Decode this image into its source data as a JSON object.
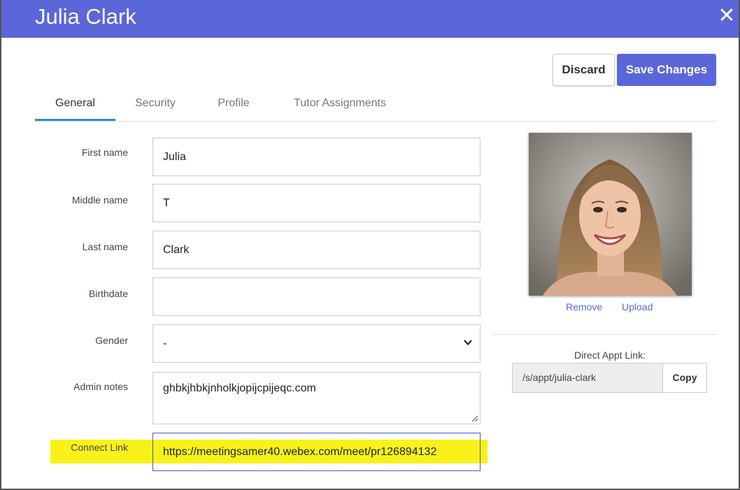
{
  "window": {
    "title": "Julia Clark"
  },
  "toolbar": {
    "discard_label": "Discard",
    "save_label": "Save Changes"
  },
  "tabs": [
    {
      "label": "General",
      "active": true
    },
    {
      "label": "Security",
      "active": false
    },
    {
      "label": "Profile",
      "active": false
    },
    {
      "label": "Tutor Assignments",
      "active": false
    }
  ],
  "form": {
    "first_name": {
      "label": "First name",
      "value": "Julia"
    },
    "middle_name": {
      "label": "Middle name",
      "value": "T"
    },
    "last_name": {
      "label": "Last name",
      "value": "Clark"
    },
    "birthdate": {
      "label": "Birthdate",
      "value": ""
    },
    "gender": {
      "label": "Gender",
      "value": "-"
    },
    "admin_notes": {
      "label": "Admin notes",
      "value": "ghbkjhbkjnholkjopijcpijeqc.com"
    },
    "connect_link": {
      "label": "Connect Link",
      "value": "https://meetingsamer40.webex.com/meet/pr126894132",
      "highlight_color": "#f7f21a"
    }
  },
  "photo": {
    "remove_label": "Remove",
    "upload_label": "Upload"
  },
  "appt": {
    "label": "Direct Appt Link:",
    "value": "/s/appt/julia-clark",
    "copy_label": "Copy"
  },
  "colors": {
    "accent": "#5b66d8",
    "tab_underline": "#2e8ed8",
    "highlight": "#f7f21a"
  },
  "icons": {
    "close": "close-icon",
    "chevron": "chevron-down-icon"
  }
}
